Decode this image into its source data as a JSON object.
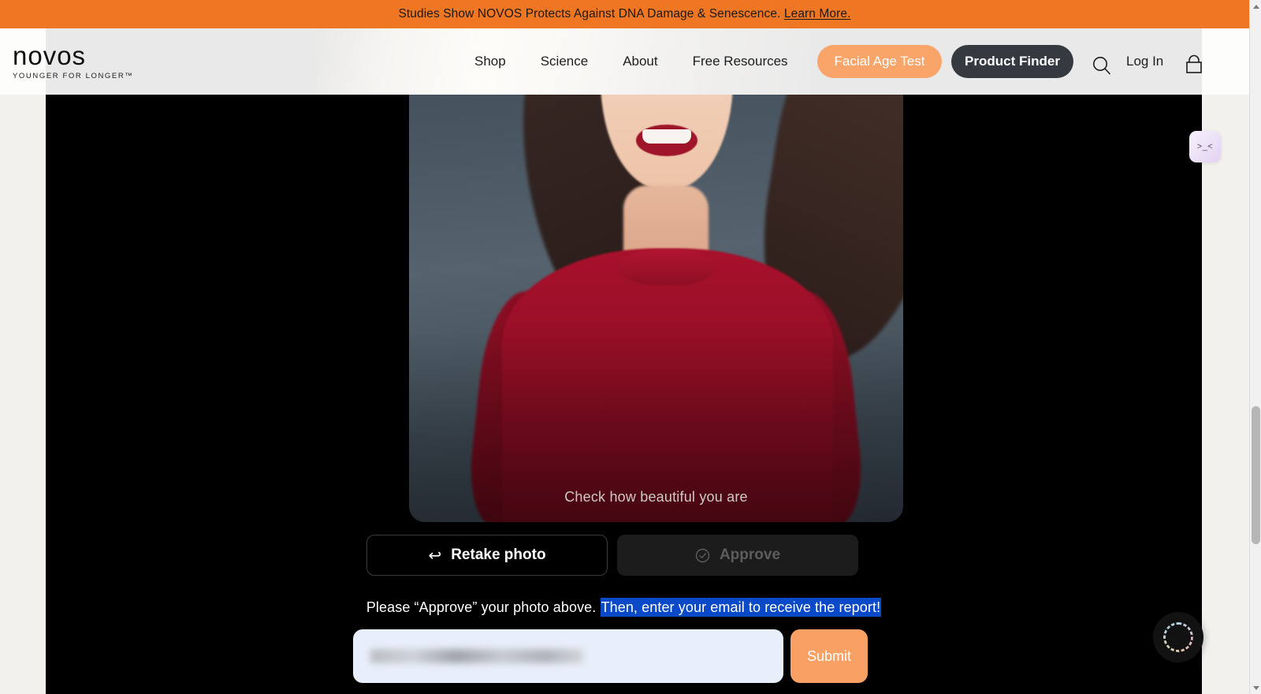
{
  "announcement": {
    "text": "Studies Show NOVOS Protects Against DNA Damage & Senescence. ",
    "link_label": "Learn More.",
    "bg_color": "#ef7622"
  },
  "header": {
    "logo_word": "novos",
    "logo_tagline": "YOUNGER FOR LONGER™",
    "nav": [
      {
        "label": "Shop"
      },
      {
        "label": "Science"
      },
      {
        "label": "About"
      },
      {
        "label": "Free Resources"
      }
    ],
    "cta_primary": {
      "label": "Facial Age Test",
      "bg_color": "#f9a469"
    },
    "cta_secondary": {
      "label": "Product Finder",
      "bg_color": "#343a40"
    },
    "search_icon": "search-icon",
    "login_label": "Log In",
    "cart_icon": "shopping-bag-icon"
  },
  "main": {
    "photo_caption": "Check how beautiful you are",
    "retake_button": {
      "label": "Retake photo",
      "icon": "↩"
    },
    "approve_button": {
      "label": "Approve",
      "icon": "✓",
      "disabled": true
    },
    "instruction": {
      "plain": "Please “Approve” your photo above. ",
      "highlighted": "Then, enter your email to receive the report!",
      "selection_color": "#0a49c7"
    },
    "email_input": {
      "value": "",
      "placeholder": "",
      "redacted": true
    },
    "submit_button": {
      "label": "Submit",
      "bg_color": "#f9a065"
    }
  },
  "widgets": {
    "kaomoji_label": ">_<",
    "assistant_icon": "assistant-orb-icon"
  },
  "scrollbar": {
    "up_arrow": "scroll-up-arrow",
    "down_arrow": "scroll-down-arrow"
  }
}
